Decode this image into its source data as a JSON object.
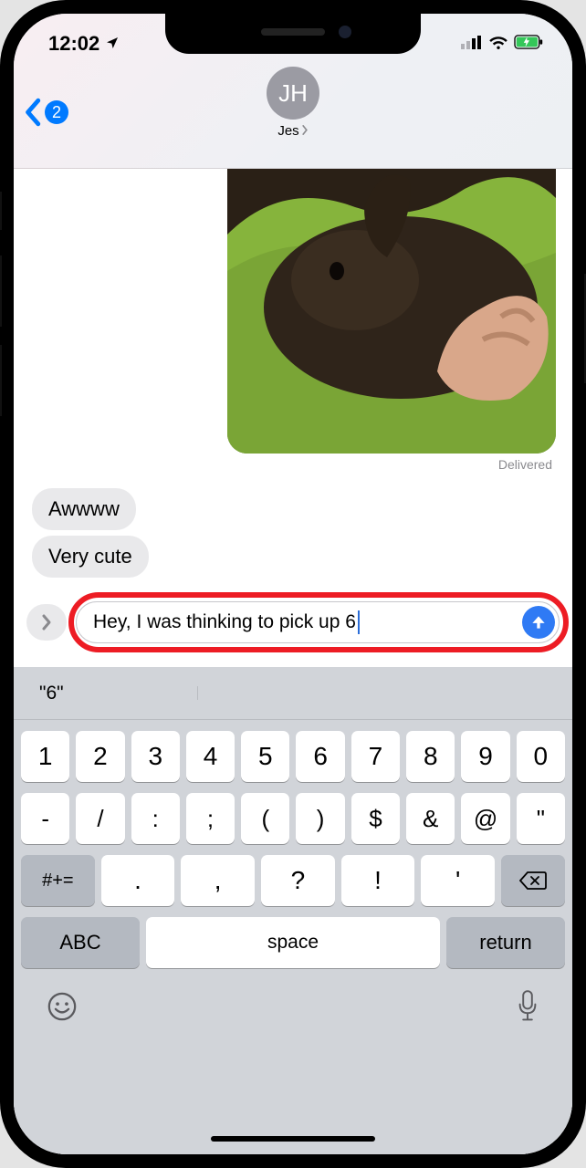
{
  "statusbar": {
    "time": "12:02"
  },
  "nav": {
    "unread_count": "2",
    "avatar_initials": "JH",
    "contact_name": "Jes"
  },
  "messages": {
    "delivered_label": "Delivered",
    "incoming": [
      "Awwww",
      "Very cute"
    ]
  },
  "compose": {
    "input_value": "Hey, I was thinking to pick up 6"
  },
  "keyboard": {
    "suggestion": "\"6\"",
    "row1": [
      "1",
      "2",
      "3",
      "4",
      "5",
      "6",
      "7",
      "8",
      "9",
      "0"
    ],
    "row2": [
      "-",
      "/",
      ":",
      ";",
      "(",
      ")",
      "$",
      "&",
      "@",
      "\""
    ],
    "symbols_key": "#+=",
    "row3": [
      ".",
      ",",
      "?",
      "!",
      "'"
    ],
    "abc_key": "ABC",
    "space_key": "space",
    "return_key": "return"
  }
}
